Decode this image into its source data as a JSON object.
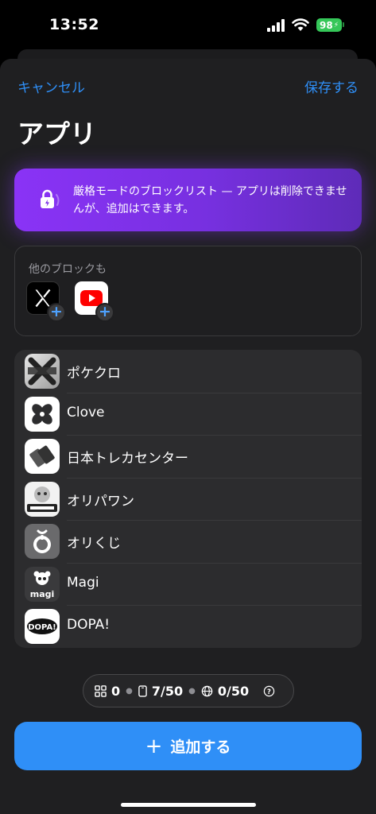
{
  "status_bar": {
    "time": "13:52",
    "battery": "98"
  },
  "nav": {
    "cancel": "キャンセル",
    "save": "保存する"
  },
  "title": "アプリ",
  "banner": {
    "text": "厳格モードのブロックリスト — アプリは削除できませんが、追加はできます。"
  },
  "others": {
    "label": "他のブロックも",
    "apps": [
      "x-app-icon",
      "youtube-app-icon"
    ]
  },
  "apps": [
    {
      "name": "ポケクロ"
    },
    {
      "name": "Clove"
    },
    {
      "name": "日本トレカセンター"
    },
    {
      "name": "オリパワン"
    },
    {
      "name": "オリくじ"
    },
    {
      "name": "Magi"
    },
    {
      "name": "DOPA!"
    }
  ],
  "stats": {
    "categories": "0",
    "apps": "7/50",
    "websites": "0/50"
  },
  "add_button": {
    "label": "追加する"
  },
  "colors": {
    "accent": "#2f8ff7",
    "banner": "#8a33f6",
    "background": "#000000"
  }
}
